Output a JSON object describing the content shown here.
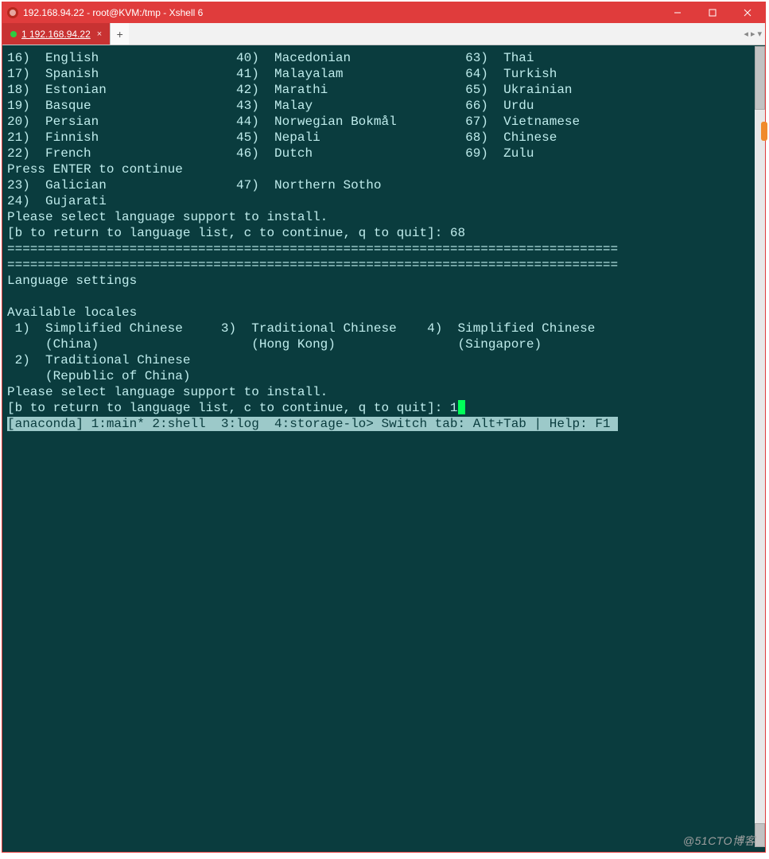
{
  "window": {
    "title": "192.168.94.22 - root@KVM:/tmp - Xshell 6"
  },
  "tab": {
    "label": "1 192.168.94.22"
  },
  "tabright": {
    "left": "◂",
    "right": "▸",
    "menu": "▾"
  },
  "col1": [
    {
      "n": "16",
      "lang": "English"
    },
    {
      "n": "17",
      "lang": "Spanish"
    },
    {
      "n": "18",
      "lang": "Estonian"
    },
    {
      "n": "19",
      "lang": "Basque"
    },
    {
      "n": "20",
      "lang": "Persian"
    },
    {
      "n": "21",
      "lang": "Finnish"
    },
    {
      "n": "22",
      "lang": "French"
    }
  ],
  "col2": [
    {
      "n": "40",
      "lang": "Macedonian"
    },
    {
      "n": "41",
      "lang": "Malayalam"
    },
    {
      "n": "42",
      "lang": "Marathi"
    },
    {
      "n": "43",
      "lang": "Malay"
    },
    {
      "n": "44",
      "lang": "Norwegian Bokmål"
    },
    {
      "n": "45",
      "lang": "Nepali"
    },
    {
      "n": "46",
      "lang": "Dutch"
    }
  ],
  "col3": [
    {
      "n": "63",
      "lang": "Thai"
    },
    {
      "n": "64",
      "lang": "Turkish"
    },
    {
      "n": "65",
      "lang": "Ukrainian"
    },
    {
      "n": "66",
      "lang": "Urdu"
    },
    {
      "n": "67",
      "lang": "Vietnamese"
    },
    {
      "n": "68",
      "lang": "Chinese"
    },
    {
      "n": "69",
      "lang": "Zulu"
    }
  ],
  "pressEnter": "Press ENTER to continue",
  "row23": {
    "n": "23",
    "lang": "Galician",
    "n2": "47",
    "lang2": "Northern Sotho"
  },
  "row24": {
    "n": "24",
    "lang": "Gujarati"
  },
  "selectPrompt": "Please select language support to install.",
  "returnPrompt": "[b to return to language list, c to continue, q to quit]: ",
  "firstInput": "68",
  "divider": "================================================================================",
  "langSettings": "Language settings",
  "availLocales": "Available locales",
  "loc": {
    "l1a": " 1)  Simplified Chinese     3)  Traditional Chinese    4)  Simplified Chinese",
    "l1b": "     (China)                    (Hong Kong)                (Singapore)",
    "l2a": " 2)  Traditional Chinese",
    "l2b": "     (Republic of China)"
  },
  "secondInput": "1",
  "statusbar": "[anaconda] 1:main* 2:shell  3:log  4:storage-lo> Switch tab: Alt+Tab | Help: F1 ",
  "watermark": "@51CTO博客"
}
